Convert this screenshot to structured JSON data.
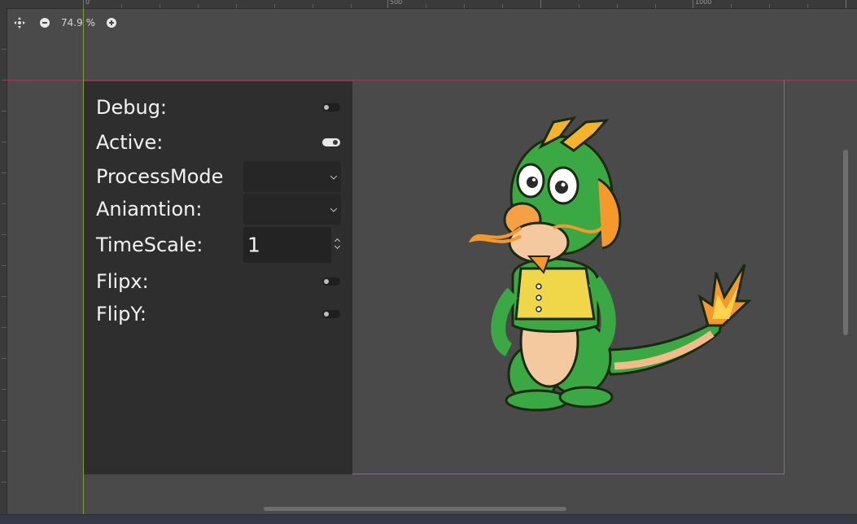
{
  "ruler": {
    "labels": [
      "0",
      "500",
      "1000"
    ]
  },
  "zoom": {
    "value": "74.9 %",
    "reset_icon": "center-view-icon",
    "out_icon": "zoom-out-icon",
    "in_icon": "zoom-in-icon"
  },
  "panel": {
    "rows": [
      {
        "label": "Debug:",
        "control": "toggle",
        "on": false
      },
      {
        "label": "Active:",
        "control": "toggle",
        "on": true
      },
      {
        "label": "ProcessMode",
        "control": "dropdown",
        "value": ""
      },
      {
        "label": "Aniamtion:",
        "control": "dropdown",
        "value": ""
      },
      {
        "label": "TimeScale:",
        "control": "spinbox",
        "value": "1"
      },
      {
        "label": "Flipx:",
        "control": "toggle",
        "on": false
      },
      {
        "label": "FlipY:",
        "control": "toggle",
        "on": false
      }
    ]
  },
  "colors": {
    "panel_bg": "#2e2e2e",
    "canvas_bg": "#4a4a4a",
    "guide_h": "#9a3f5a",
    "guide_v": "#7fa130",
    "dragon_green": "#3aa843"
  },
  "image": {
    "subject": "cartoon green dragon character"
  }
}
